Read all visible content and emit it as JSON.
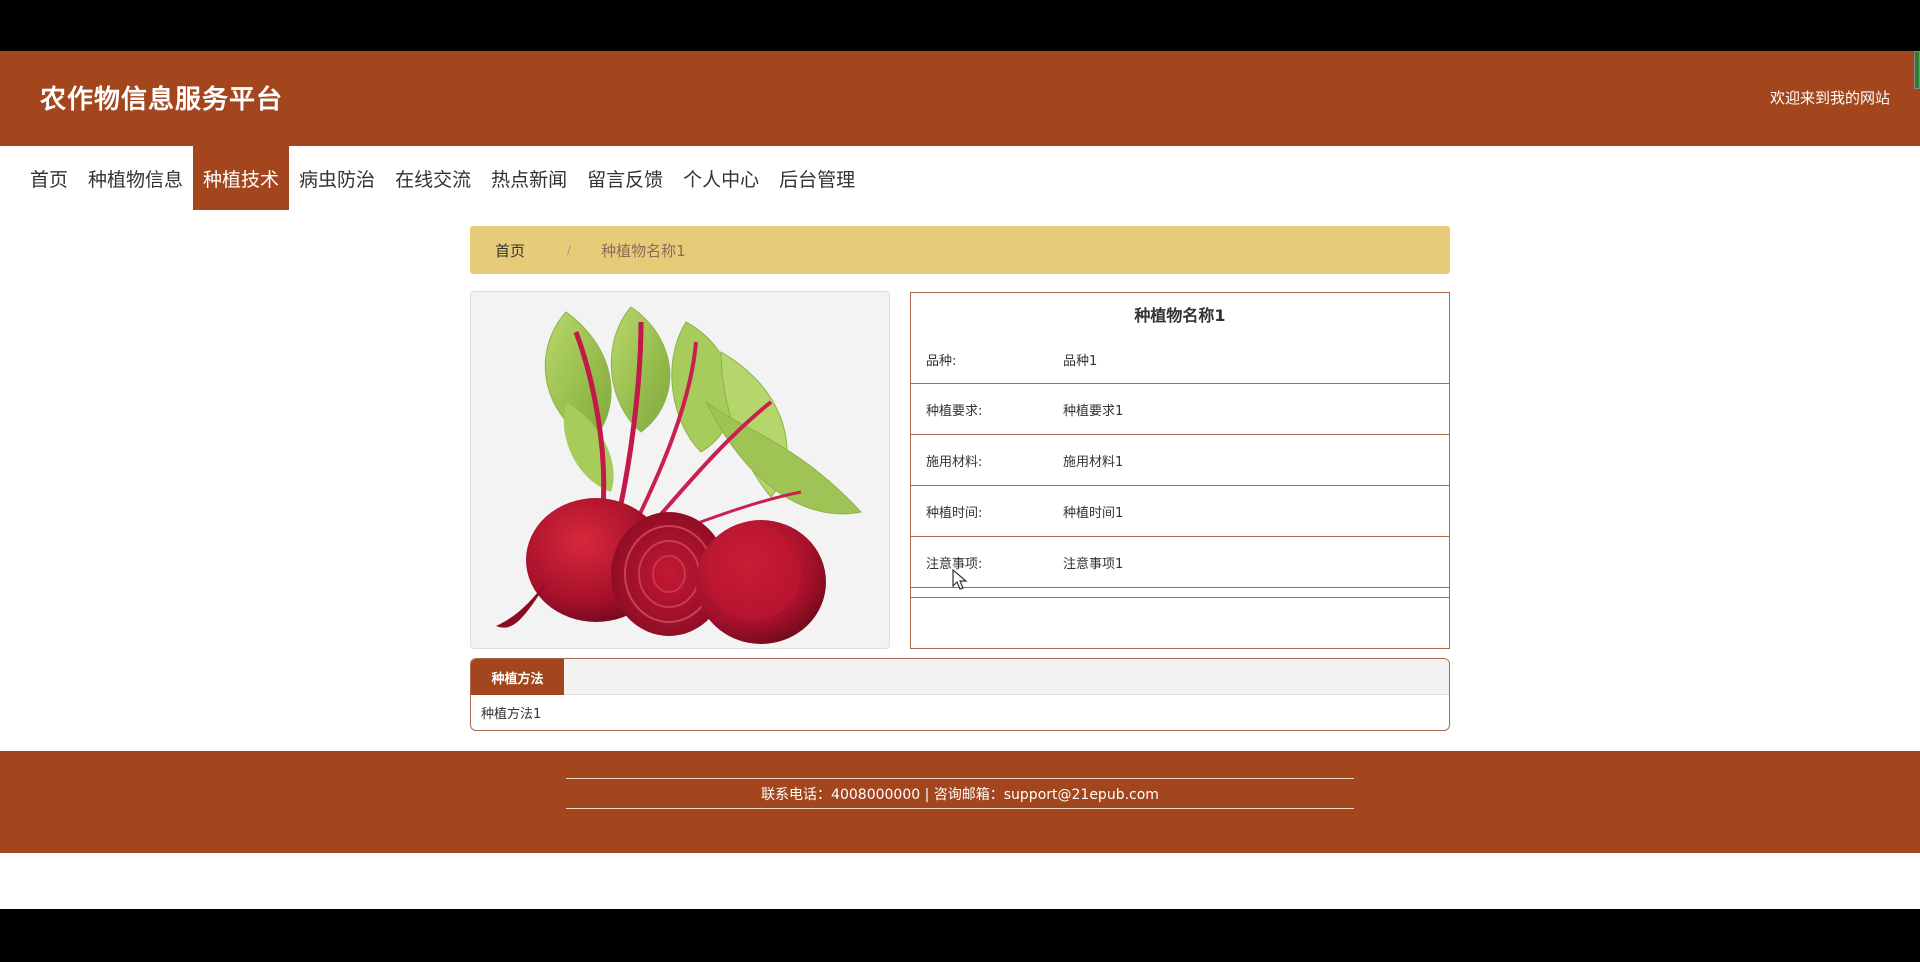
{
  "header": {
    "site_title": "农作物信息服务平台",
    "welcome": "欢迎来到我的网站"
  },
  "nav": {
    "items": [
      "首页",
      "种植物信息",
      "种植技术",
      "病虫防治",
      "在线交流",
      "热点新闻",
      "留言反馈",
      "个人中心",
      "后台管理"
    ],
    "active_index": 2
  },
  "breadcrumb": {
    "home": "首页",
    "separator": "/",
    "current": "种植物名称1"
  },
  "detail": {
    "image_alt": "beetroot",
    "name": "种植物名称1",
    "fields": [
      {
        "label": "品种:",
        "value": "品种1"
      },
      {
        "label": "种植要求:",
        "value": "种植要求1"
      },
      {
        "label": "施用材料:",
        "value": "施用材料1"
      },
      {
        "label": "种植时间:",
        "value": "种植时间1"
      },
      {
        "label": "注意事项:",
        "value": "注意事项1"
      }
    ]
  },
  "tabs": {
    "active_label": "种植方法",
    "content": "种植方法1"
  },
  "footer": {
    "contact": "联系电话：4008000000 | 咨询邮箱：support@21epub.com"
  },
  "colors": {
    "brand": "#a3461d",
    "breadcrumb_bg": "#e8cb78",
    "border": "#a86a4c"
  }
}
